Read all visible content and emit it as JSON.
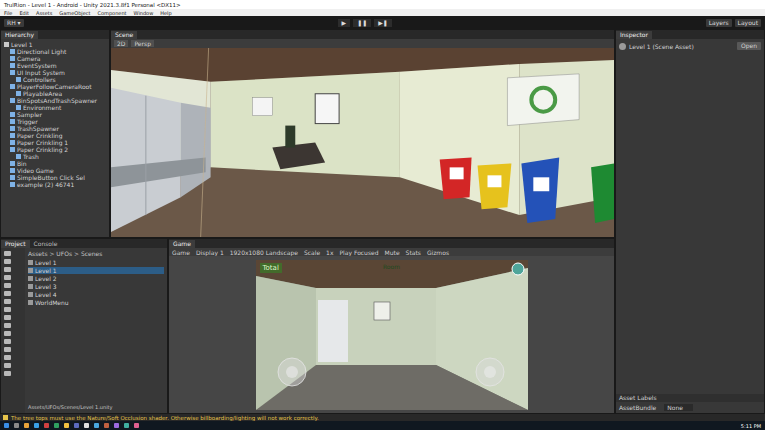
{
  "window": {
    "title": "TrulRion - Level 1 - Android - Unity 2021.3.8f1 Personal <DX11>"
  },
  "menu": [
    "File",
    "Edit",
    "Assets",
    "GameObject",
    "Component",
    "Window",
    "Help"
  ],
  "toolbar": {
    "account": "RH ▾",
    "play": [
      "▶",
      "❚❚",
      "▶❚"
    ],
    "layers": "Layers",
    "layout": "Layout"
  },
  "hierarchy": {
    "title": "Hierarchy",
    "items": [
      {
        "label": "Level 1",
        "depth": 0,
        "selected": false
      },
      {
        "label": "Directional Light",
        "depth": 1,
        "selected": false
      },
      {
        "label": "Camera",
        "depth": 1,
        "selected": false
      },
      {
        "label": "EventSystem",
        "depth": 1,
        "selected": false
      },
      {
        "label": "UI Input System",
        "depth": 1,
        "selected": false
      },
      {
        "label": "Controllers",
        "depth": 2,
        "selected": false
      },
      {
        "label": "PlayerFollowCameraRoot",
        "depth": 1,
        "selected": false
      },
      {
        "label": "PlayableArea",
        "depth": 2,
        "selected": false
      },
      {
        "label": "BinSpotsAndTrashSpawner",
        "depth": 1,
        "selected": false
      },
      {
        "label": "Environment",
        "depth": 2,
        "selected": false
      },
      {
        "label": "Sampler",
        "depth": 1,
        "selected": false
      },
      {
        "label": "Trigger",
        "depth": 1,
        "selected": false
      },
      {
        "label": "TrashSpawner",
        "depth": 1,
        "selected": false
      },
      {
        "label": "Paper Crinkling",
        "depth": 1,
        "selected": false
      },
      {
        "label": "Paper Crinkling 1",
        "depth": 1,
        "selected": false
      },
      {
        "label": "Paper Crinkling 2",
        "depth": 1,
        "selected": false
      },
      {
        "label": "Trash",
        "depth": 2,
        "selected": false
      },
      {
        "label": "Bin",
        "depth": 1,
        "selected": false
      },
      {
        "label": "Video Game",
        "depth": 1,
        "selected": false
      },
      {
        "label": "SimpleButton Click Sel",
        "depth": 1,
        "selected": false
      },
      {
        "label": "example (2) 46741",
        "depth": 1,
        "selected": false
      }
    ]
  },
  "scene": {
    "tab": "Scene",
    "tools": [
      "2D",
      "Persp"
    ]
  },
  "project": {
    "tabs": [
      {
        "label": "Project",
        "selected": true
      },
      {
        "label": "Console",
        "selected": false
      }
    ],
    "breadcrumb": "Assets > UFOs > Scenes",
    "items": [
      {
        "label": "Level 1",
        "selected": false
      },
      {
        "label": "Level 1",
        "selected": true
      },
      {
        "label": "Level 2",
        "selected": false
      },
      {
        "label": "Level 3",
        "selected": false
      },
      {
        "label": "Level 4",
        "selected": false
      },
      {
        "label": "WorldMenu",
        "selected": false
      }
    ],
    "footer": "Assets/UFOs/Scenes/Level 1.unity"
  },
  "game": {
    "tab": "Game",
    "controls": [
      "Game",
      "Display 1",
      "1920x1080 Landscape",
      "Scale",
      "1x",
      "Play Focused",
      "Mute",
      "Stats",
      "Gizmos"
    ],
    "hud": {
      "total": "Total",
      "room": "Room"
    }
  },
  "inspector": {
    "title": "Inspector",
    "asset": "Level 1 (Scene Asset)",
    "open": "Open",
    "labels": "Asset Labels",
    "bundle_label": "AssetBundle",
    "bundle_value": "None"
  },
  "status_bar": "The tree tops must use the Nature/Soft Occlusion shader. Otherwise billboarding/lighting will not work correctly.",
  "taskbar": {
    "time": "5:11 PM"
  }
}
